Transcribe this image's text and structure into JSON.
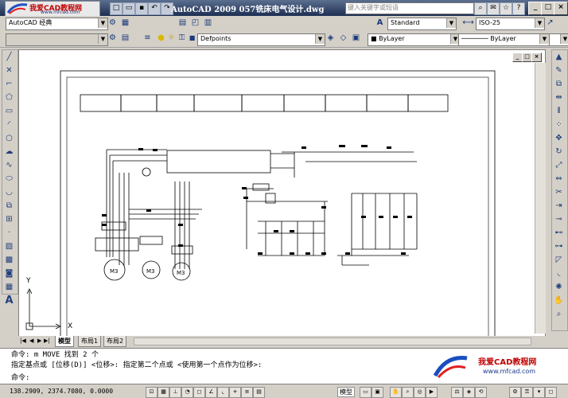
{
  "window": {
    "title": "AutoCAD 2009 057铣床电气设计.dwg",
    "search_placeholder": "键入关键字或短语",
    "logo_brand": "我爱CAD教程网",
    "logo_url": "www.mfcad.com"
  },
  "toolbar1": {
    "workspace": "AutoCAD 经典",
    "text_style": "Standard",
    "dim_style": "ISO-25",
    "text_style_icon": "A-text-icon",
    "dim_style_icon": "dimension-icon"
  },
  "toolbar2": {
    "layer": "Defpoints",
    "color": "ByLayer",
    "linetype": "ByLayer"
  },
  "tabs": [
    "模型",
    "布局1",
    "布局2"
  ],
  "command": {
    "line1": "命令: m MOVE 找到 2 个",
    "line2": "指定基点或 [位移(D)] <位移>:  指定第二个点或 <使用第一个点作为位移>:",
    "prompt": "命令:"
  },
  "watermark": {
    "brand": "我爱CAD教程网",
    "url": "www.mfcad.com"
  },
  "status": {
    "coords": "138.2909,  2374.7080, 0.0000",
    "model_label": "模型"
  },
  "title_block_cells": [
    "",
    "",
    "",
    "",
    "",
    "",
    "",
    "",
    ""
  ],
  "ucs": {
    "x_label": "X",
    "y_label": "Y"
  }
}
